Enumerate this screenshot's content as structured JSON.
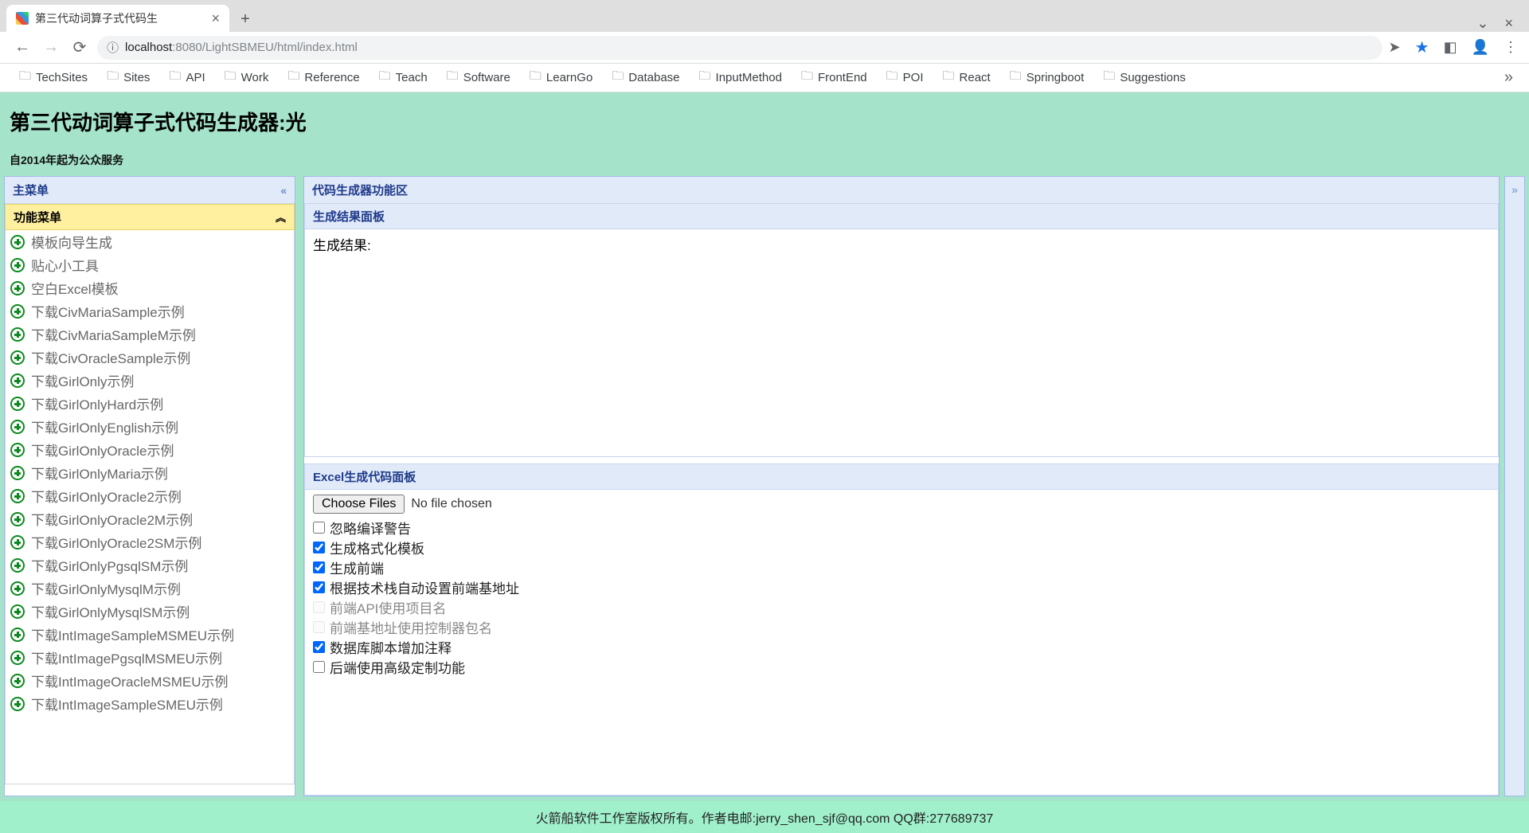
{
  "browser": {
    "tab_title": "第三代动词算子式代码生",
    "url_host": "localhost",
    "url_port": ":8080",
    "url_path": "/LightSBMEU/html/index.html",
    "bookmarks": [
      "TechSites",
      "Sites",
      "API",
      "Work",
      "Reference",
      "Teach",
      "Software",
      "LearnGo",
      "Database",
      "InputMethod",
      "FrontEnd",
      "POI",
      "React",
      "Springboot",
      "Suggestions"
    ]
  },
  "header": {
    "title": "第三代动词算子式代码生成器:光",
    "subtitle": "自2014年起为公众服务"
  },
  "sidebar": {
    "title": "主菜单",
    "section_title": "功能菜单",
    "items": [
      "模板向导生成",
      "贴心小工具",
      "空白Excel模板",
      "下载CivMariaSample示例",
      "下载CivMariaSampleM示例",
      "下载CivOracleSample示例",
      "下载GirlOnly示例",
      "下载GirlOnlyHard示例",
      "下载GirlOnlyEnglish示例",
      "下载GirlOnlyOracle示例",
      "下载GirlOnlyMaria示例",
      "下载GirlOnlyOracle2示例",
      "下载GirlOnlyOracle2M示例",
      "下载GirlOnlyOracle2SM示例",
      "下载GirlOnlyPgsqlSM示例",
      "下载GirlOnlyMysqlM示例",
      "下载GirlOnlyMysqlSM示例",
      "下载IntImageSampleMSMEU示例",
      "下载IntImagePgsqlMSMEU示例",
      "下载IntImageOracleMSMEU示例",
      "下载IntImageSampleSMEU示例"
    ]
  },
  "main": {
    "title": "代码生成器功能区",
    "result_panel_title": "生成结果面板",
    "result_label": "生成结果:",
    "excel_panel_title": "Excel生成代码面板",
    "file_button": "Choose Files",
    "file_status": "No file chosen",
    "checkboxes": [
      {
        "label": "忽略编译警告",
        "checked": false,
        "disabled": false
      },
      {
        "label": "生成格式化模板",
        "checked": true,
        "disabled": false
      },
      {
        "label": "生成前端",
        "checked": true,
        "disabled": false
      },
      {
        "label": "根据技术栈自动设置前端基地址",
        "checked": true,
        "disabled": false
      },
      {
        "label": "前端API使用项目名",
        "checked": false,
        "disabled": true
      },
      {
        "label": "前端基地址使用控制器包名",
        "checked": false,
        "disabled": true
      },
      {
        "label": "数据库脚本增加注释",
        "checked": true,
        "disabled": false
      },
      {
        "label": "后端使用高级定制功能",
        "checked": false,
        "disabled": false
      }
    ]
  },
  "footer": {
    "text": "火箭船软件工作室版权所有。作者电邮:jerry_shen_sjf@qq.com QQ群:277689737"
  }
}
